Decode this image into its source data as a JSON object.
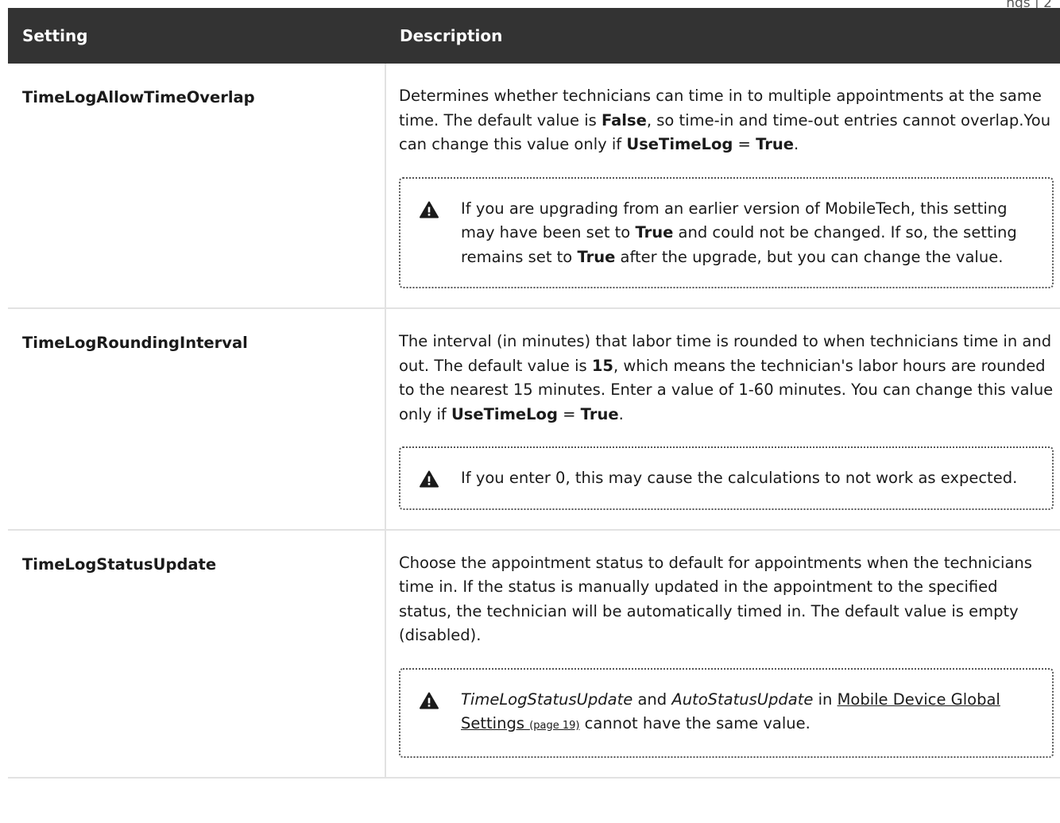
{
  "page_header": "ngs | 2",
  "table": {
    "headers": {
      "setting": "Setting",
      "description": "Description"
    },
    "rows": [
      {
        "setting": "TimeLogAllowTimeOverlap",
        "description": {
          "t1": "Determines whether technicians can time in to multiple appointments at the same time. The default value is ",
          "b1": "False",
          "t2": ", so time-in and time-out entries cannot overlap.You can change this value only if ",
          "b2": "UseTimeLog",
          "t3": " = ",
          "b3": "True",
          "t4": "."
        },
        "note": {
          "icon": "warning-icon",
          "t1": "If you are upgrading from an earlier version of MobileTech, this setting may have been set to ",
          "b1": "True",
          "t2": " and could not be changed. If so, the setting remains set to ",
          "b2": "True",
          "t3": " after the upgrade, but you can change the value."
        }
      },
      {
        "setting": "TimeLogRoundingInterval",
        "description": {
          "t1": "The interval (in minutes) that labor time is rounded to when technicians time in and out. The default value is ",
          "b1": "15",
          "t2": ", which means the technician's labor hours are rounded to the nearest 15 minutes. Enter a value of 1-60 minutes. You can change this value only if ",
          "b2": "UseTimeLog",
          "t3": " = ",
          "b3": "True",
          "t4": "."
        },
        "note": {
          "icon": "warning-icon",
          "text": "If you enter 0, this may cause the calculations to not work as expected."
        }
      },
      {
        "setting": "TimeLogStatusUpdate",
        "description": {
          "text": "Choose the appointment status to default for appointments when the technicians time in. If the status is manually updated in the appointment to the specified status, the technician will be automatically timed in. The default value is empty (disabled)."
        },
        "note": {
          "icon": "warning-icon",
          "i1": "TimeLogStatusUpdate",
          "t1": " and ",
          "i2": "AutoStatusUpdate",
          "t2": " in ",
          "link": "Mobile Device Global Settings",
          "page_ref": "(page 19)",
          "t3": "  cannot have the same value."
        }
      }
    ]
  },
  "colors": {
    "header_bg": "#333333",
    "header_text": "#ffffff",
    "border": "#e2e2e2"
  }
}
